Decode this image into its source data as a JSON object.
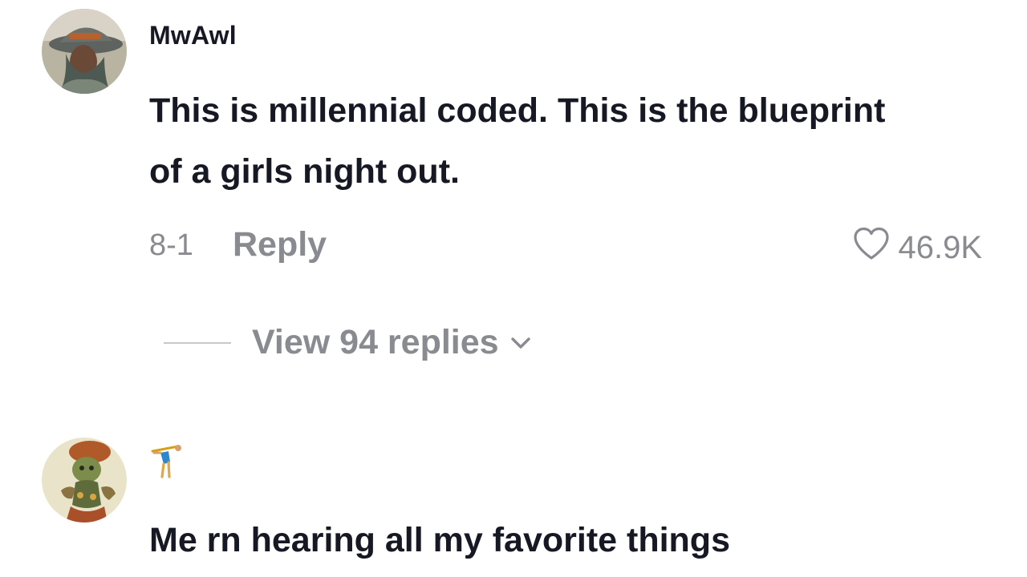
{
  "comments": [
    {
      "username": "MwAwl",
      "text_line1": "This is millennial coded. This is the blueprint",
      "text_line2": "of a girls night out.",
      "date": "8-1",
      "reply_label": "Reply",
      "likes": "46.9K",
      "view_replies_label": "View 94 replies"
    },
    {
      "username_icon": "gymnast-emoji-icon",
      "text_line1": "Me rn hearing all my favorite things"
    }
  ],
  "icons": {
    "like": "heart-outline-icon",
    "expand": "chevron-down-icon"
  },
  "colors": {
    "text_primary": "#161823",
    "text_secondary": "#8a8b91",
    "divider": "#c7c8cc"
  }
}
